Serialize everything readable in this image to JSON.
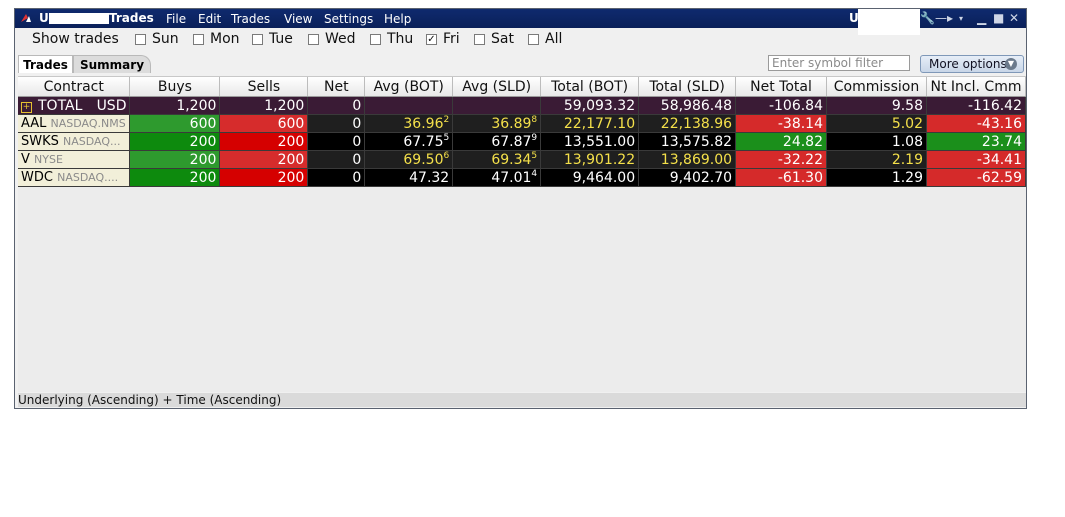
{
  "window": {
    "account_prefix": "U",
    "title": "Trades",
    "account_right": "U",
    "menu": [
      "File",
      "Edit",
      "Trades",
      "View",
      "Settings",
      "Help"
    ]
  },
  "show_trades": {
    "label": "Show trades",
    "days": [
      {
        "label": "Sun",
        "checked": false
      },
      {
        "label": "Mon",
        "checked": false
      },
      {
        "label": "Tue",
        "checked": false
      },
      {
        "label": "Wed",
        "checked": false
      },
      {
        "label": "Thu",
        "checked": false
      },
      {
        "label": "Fri",
        "checked": true
      },
      {
        "label": "Sat",
        "checked": false
      },
      {
        "label": "All",
        "checked": false
      }
    ]
  },
  "tabs": [
    "Trades",
    "Summary"
  ],
  "filter": {
    "placeholder": "Enter symbol filter"
  },
  "more_options": "More options",
  "columns": [
    "Contract",
    "Buys",
    "Sells",
    "Net",
    "Avg (BOT)",
    "Avg (SLD)",
    "Total (BOT)",
    "Total (SLD)",
    "Net Total",
    "Commission",
    "Nt Incl. Cmm"
  ],
  "total_row": {
    "contract": "TOTAL",
    "currency": "USD",
    "buys": "1,200",
    "sells": "1,200",
    "net": "0",
    "avg_bot": "",
    "avg_sld": "",
    "total_bot": "59,093.32",
    "total_sld": "58,986.48",
    "net_total": "-106.84",
    "commission": "9.58",
    "nt_incl": "-116.42"
  },
  "rows": [
    {
      "symbol": "AAL",
      "exchange": "NASDAQ.NMS",
      "buys": "600",
      "sells": "600",
      "net": "0",
      "avg_bot": "36.96",
      "avg_bot_sup": "2",
      "avg_sld": "36.89",
      "avg_sld_sup": "8",
      "total_bot": "22,177.10",
      "total_sld": "22,138.96",
      "net_total": "-38.14",
      "commission": "5.02",
      "nt_incl": "-43.16"
    },
    {
      "symbol": "SWKS",
      "exchange": "NASDAQ...",
      "buys": "200",
      "sells": "200",
      "net": "0",
      "avg_bot": "67.75",
      "avg_bot_sup": "5",
      "avg_sld": "67.87",
      "avg_sld_sup": "9",
      "total_bot": "13,551.00",
      "total_sld": "13,575.82",
      "net_total": "24.82",
      "commission": "1.08",
      "nt_incl": "23.74"
    },
    {
      "symbol": "V",
      "exchange": "NYSE",
      "buys": "200",
      "sells": "200",
      "net": "0",
      "avg_bot": "69.50",
      "avg_bot_sup": "6",
      "avg_sld": "69.34",
      "avg_sld_sup": "5",
      "total_bot": "13,901.22",
      "total_sld": "13,869.00",
      "net_total": "-32.22",
      "commission": "2.19",
      "nt_incl": "-34.41"
    },
    {
      "symbol": "WDC",
      "exchange": "NASDAQ....",
      "buys": "200",
      "sells": "200",
      "net": "0",
      "avg_bot": "47.32",
      "avg_bot_sup": "",
      "avg_sld": "47.01",
      "avg_sld_sup": "4",
      "total_bot": "9,464.00",
      "total_sld": "9,402.70",
      "net_total": "-61.30",
      "commission": "1.29",
      "nt_incl": "-62.59"
    }
  ],
  "status": "Underlying (Ascending)  +  Time (Ascending)",
  "icons": [
    "app-logo-icon",
    "wrench-icon",
    "pin-icon",
    "minimize-icon",
    "maximize-icon",
    "close-icon",
    "expand-icon",
    "dropdown-arrow-icon"
  ]
}
